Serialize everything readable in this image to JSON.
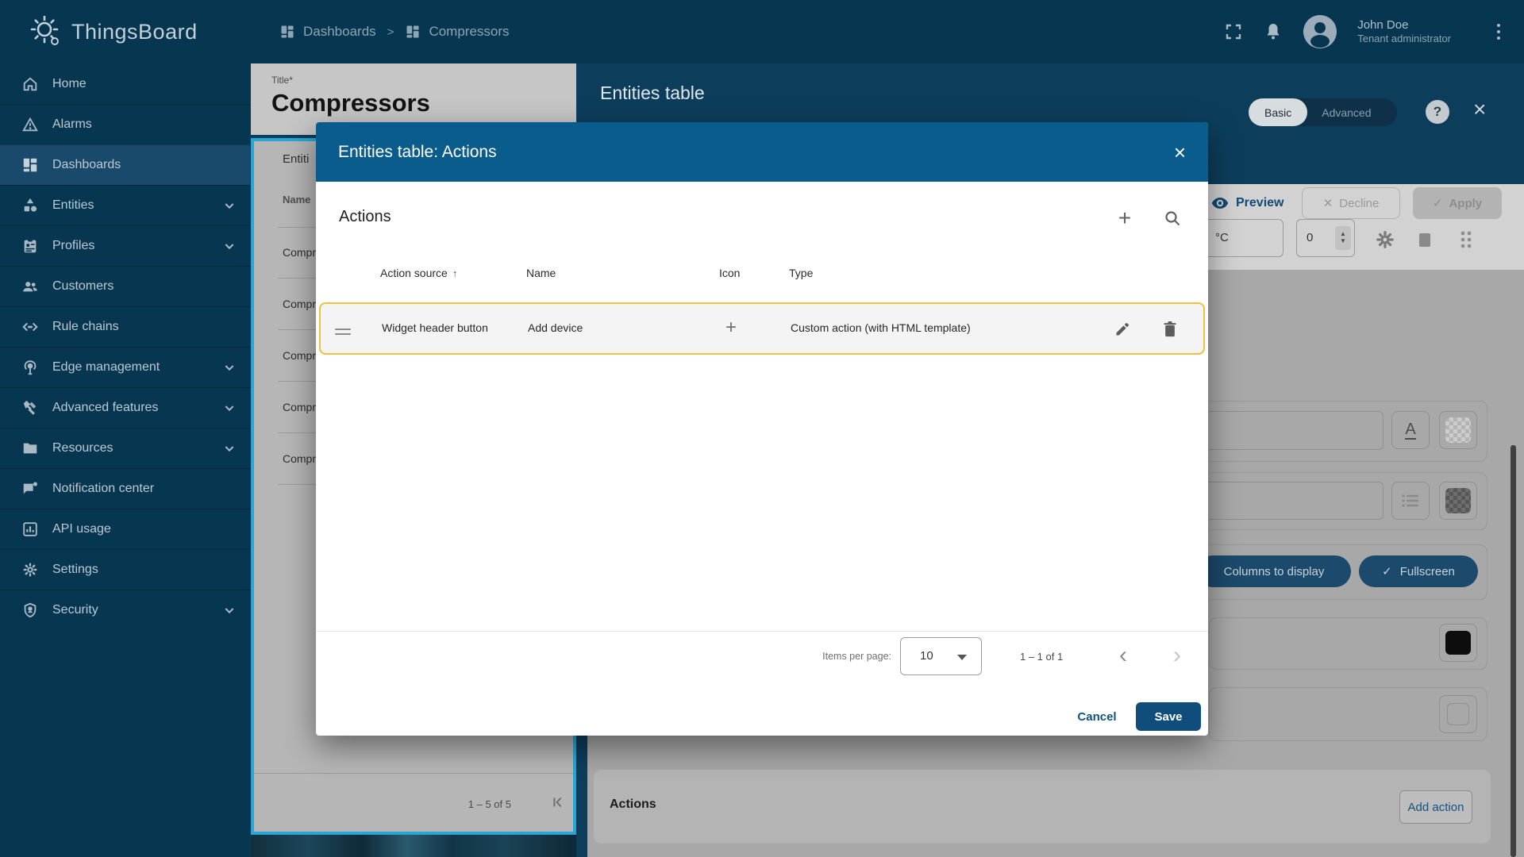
{
  "brand": {
    "name": "ThingsBoard"
  },
  "breadcrumb": {
    "separator": ">",
    "items": [
      {
        "label": "Dashboards",
        "icon": "dashboards-icon"
      },
      {
        "label": "Compressors",
        "icon": "dashboard-icon"
      }
    ]
  },
  "topbar": {
    "user_name": "John Doe",
    "user_role": "Tenant administrator"
  },
  "sidebar": {
    "items": [
      {
        "label": "Home",
        "icon": "home-icon",
        "selected": false,
        "expandable": false
      },
      {
        "label": "Alarms",
        "icon": "alarms-icon",
        "selected": false,
        "expandable": false
      },
      {
        "label": "Dashboards",
        "icon": "dashboards-icon",
        "selected": true,
        "expandable": false
      },
      {
        "label": "Entities",
        "icon": "entities-icon",
        "selected": false,
        "expandable": true
      },
      {
        "label": "Profiles",
        "icon": "profiles-icon",
        "selected": false,
        "expandable": true
      },
      {
        "label": "Customers",
        "icon": "customers-icon",
        "selected": false,
        "expandable": false
      },
      {
        "label": "Rule chains",
        "icon": "rule-chains-icon",
        "selected": false,
        "expandable": false
      },
      {
        "label": "Edge management",
        "icon": "edge-management-icon",
        "selected": false,
        "expandable": true
      },
      {
        "label": "Advanced features",
        "icon": "advanced-features-icon",
        "selected": false,
        "expandable": true
      },
      {
        "label": "Resources",
        "icon": "resources-icon",
        "selected": false,
        "expandable": true
      },
      {
        "label": "Notification center",
        "icon": "notification-center-icon",
        "selected": false,
        "expandable": false
      },
      {
        "label": "API usage",
        "icon": "api-usage-icon",
        "selected": false,
        "expandable": false
      },
      {
        "label": "Settings",
        "icon": "settings-icon",
        "selected": false,
        "expandable": false
      },
      {
        "label": "Security",
        "icon": "security-icon",
        "selected": false,
        "expandable": true
      }
    ]
  },
  "widget_editor": {
    "title_field": {
      "label": "Title*",
      "value": "Compressors"
    },
    "widget_title": "Entities table",
    "mode_toggle": {
      "options": [
        "Basic",
        "Advanced"
      ],
      "selected": "Basic"
    },
    "help": "?",
    "close": "×",
    "preview": "Preview",
    "decline": "Decline",
    "apply": "Apply",
    "unit_value": "°C",
    "decimals_value": "0",
    "chips": [
      "Columns to display",
      "Fullscreen"
    ],
    "actions_section_label": "Actions",
    "add_action_label": "Add action"
  },
  "widget_preview": {
    "tab_label": "Entiti",
    "column_header": "Name",
    "rows": [
      "Compr",
      "Compr",
      "Compr",
      "Compr",
      "Compr"
    ],
    "pagination": "1 – 5 of 5"
  },
  "dialog": {
    "title": "Entities table: Actions",
    "close": "×",
    "section_title": "Actions",
    "table": {
      "headers": [
        "Action source",
        "Name",
        "Icon",
        "Type"
      ],
      "sort_column": "Action source",
      "sort_direction": "asc",
      "sort_arrow": "↑",
      "rows": [
        {
          "action_source": "Widget header button",
          "name": "Add device",
          "icon": "plus",
          "type": "Custom action (with HTML template)"
        }
      ]
    },
    "pagination": {
      "label": "Items per page:",
      "page_size": "10",
      "range": "1 – 1 of 1"
    },
    "cancel_label": "Cancel",
    "save_label": "Save"
  },
  "colors": {
    "primary": "#0f4e7b",
    "dialog_header": "#0a5c8d",
    "sidebar_bg": "#073750",
    "selected_item_bg": "#1a4a6b",
    "highlight_border": "#f3c13d",
    "edit_area_bg": "#0c3e5c"
  }
}
